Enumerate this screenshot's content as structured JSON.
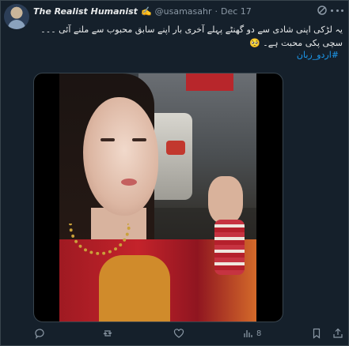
{
  "author": {
    "display_name": "The Realist Humanist",
    "name_emoji": "✍️",
    "handle": "@usamasahr",
    "separator": "·",
    "date": "Dec 17"
  },
  "post": {
    "text": "یہ لڑکی اپنی شادی سے دو گھنٹے پہلے آخری بار اپنے سابق محبوب سے ملنے آئی ۔۔۔سچی پکی محبت ہے۔ 🥺",
    "hashtag": "#اردو_زبان"
  },
  "media": {
    "type": "video"
  },
  "actions": {
    "reply_icon": "reply-icon",
    "retweet_icon": "retweet-icon",
    "like_icon": "heart-icon",
    "views_icon": "views-icon",
    "views_count": "8",
    "bookmark_icon": "bookmark-icon",
    "share_icon": "share-icon"
  },
  "colors": {
    "background": "#15202b",
    "text": "#e7e9ea",
    "muted": "#8b98a5",
    "link": "#1d9bf0",
    "border": "#38444d"
  }
}
